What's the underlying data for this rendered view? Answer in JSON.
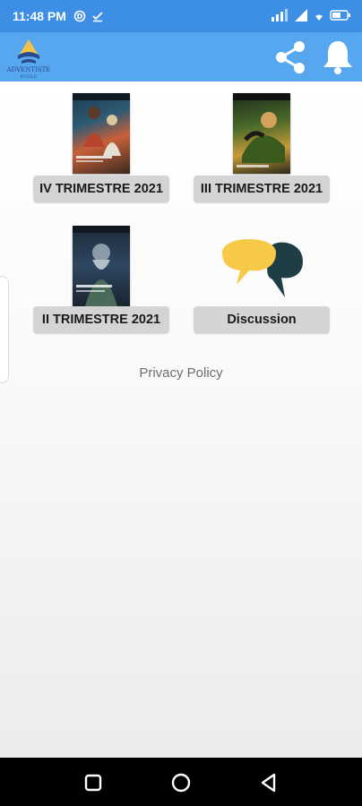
{
  "status_bar": {
    "time": "11:48 PM",
    "left_icons": [
      "data-saver-icon",
      "download-check-icon"
    ],
    "right_icons": [
      "signal-icon",
      "signal-icon",
      "wifi-icon",
      "battery-icon"
    ]
  },
  "app_bar": {
    "logo_icon": "adventist-logo-icon",
    "share_icon": "share-icon",
    "notifications_icon": "bell-icon"
  },
  "cards": [
    {
      "label": "IV TRIMESTRE 2021",
      "cover_icon": "lesson-cover-image"
    },
    {
      "label": "III TRIMESTRE 2021",
      "cover_icon": "lesson-cover-image"
    },
    {
      "label": "II TRIMESTRE 2021",
      "cover_icon": "lesson-cover-image"
    },
    {
      "label": "Discussion",
      "cover_icon": "chat-bubbles-icon"
    }
  ],
  "privacy_link": "Privacy Policy",
  "nav_bar": {
    "buttons": [
      "recents-square-icon",
      "home-circle-icon",
      "back-triangle-icon"
    ]
  },
  "colors": {
    "status_bar": "#3d8fe6",
    "app_bar": "#56a7f0",
    "label_bg": "#d4d4d4",
    "chat_yellow": "#f7c948",
    "chat_dark": "#1f3d45"
  }
}
